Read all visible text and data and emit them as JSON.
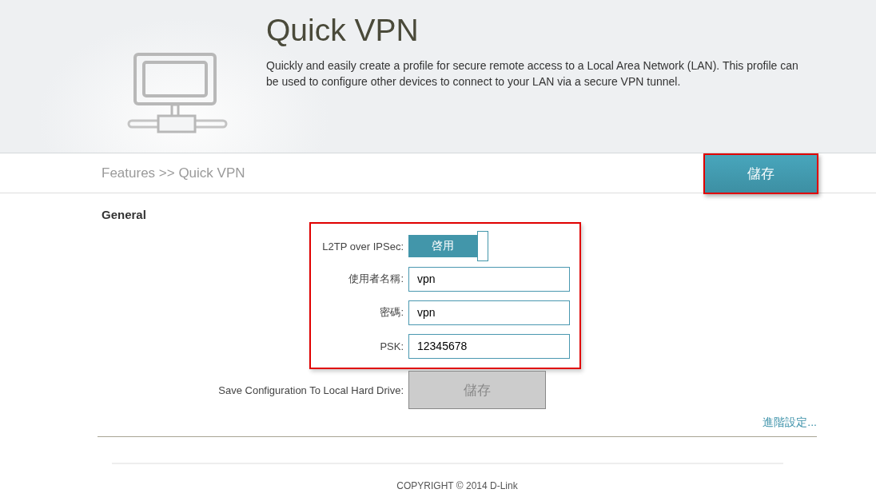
{
  "header": {
    "title": "Quick VPN",
    "description": "Quickly and easily create a profile for secure remote access to a Local Area Network (LAN). This profile can be used to configure other devices to connect to your LAN via a secure VPN tunnel."
  },
  "breadcrumb": "Features >> Quick VPN",
  "save_button": {
    "label": "儲存",
    "highlighted": true
  },
  "section": {
    "title": "General",
    "highlighted": true
  },
  "fields": [
    {
      "kind": "toggle",
      "label": "L2TP over IPSec:",
      "text": "啓用",
      "on": true
    },
    {
      "kind": "input",
      "label": "使用者名稱:",
      "value": "vpn"
    },
    {
      "kind": "input",
      "label": "密碼:",
      "value": "vpn"
    },
    {
      "kind": "input",
      "label": "PSK:",
      "value": "12345678"
    }
  ],
  "save_config": {
    "label": "Save Configuration To Local Hard Drive:",
    "button": "儲存",
    "disabled": true
  },
  "advanced_link": "進階設定...",
  "footer": "COPYRIGHT © 2014 D-Link"
}
